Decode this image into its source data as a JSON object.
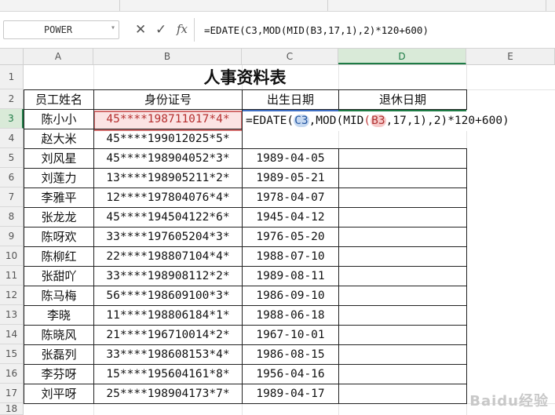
{
  "formula_bar": {
    "name_box": "POWER",
    "formula": "=EDATE(C3,MOD(MID(B3,17,1),2)*120+600)"
  },
  "icons": [
    "cancel-icon",
    "check-icon",
    "fx-icon",
    "dropdown-icon"
  ],
  "columns": [
    "A",
    "B",
    "C",
    "D",
    "E"
  ],
  "rows": [
    "1",
    "2",
    "3",
    "4",
    "5",
    "6",
    "7",
    "8",
    "9",
    "10",
    "11",
    "12",
    "13",
    "14",
    "15",
    "16",
    "17",
    "18"
  ],
  "sheet": {
    "title": "人事资料表",
    "headers": {
      "name": "员工姓名",
      "id": "身份证号",
      "birth": "出生日期",
      "retire": "退休日期"
    },
    "active_formula": {
      "prefix": "=EDATE(",
      "ref1": "C3",
      "mid1": ",MOD(MID",
      "open": "(",
      "ref2": "B3",
      "rest": ",17,1)",
      "tail": ",2)*120+600)"
    },
    "records": [
      {
        "name": "陈小小",
        "id": "45****198711017*4*",
        "birth": ""
      },
      {
        "name": "赵大米",
        "id": "45****199012025*5*",
        "birth": ""
      },
      {
        "name": "刘风星",
        "id": "45****198904052*3*",
        "birth": "1989-04-05"
      },
      {
        "name": "刘莲力",
        "id": "13****198905211*2*",
        "birth": "1989-05-21"
      },
      {
        "name": "李雅平",
        "id": "12****197804076*4*",
        "birth": "1978-04-07"
      },
      {
        "name": "张龙龙",
        "id": "45****194504122*6*",
        "birth": "1945-04-12"
      },
      {
        "name": "陈呀欢",
        "id": "33****197605204*3*",
        "birth": "1976-05-20"
      },
      {
        "name": "陈柳红",
        "id": "22****198807104*4*",
        "birth": "1988-07-10"
      },
      {
        "name": "张甜吖",
        "id": "33****198908112*2*",
        "birth": "1989-08-11"
      },
      {
        "name": "陈马梅",
        "id": "56****198609100*3*",
        "birth": "1986-09-10"
      },
      {
        "name": "李晓",
        "id": "11****198806184*1*",
        "birth": "1988-06-18"
      },
      {
        "name": "陈晓风",
        "id": "21****196710014*2*",
        "birth": "1967-10-01"
      },
      {
        "name": "张磊列",
        "id": "33****198608153*4*",
        "birth": "1986-08-15"
      },
      {
        "name": "李芬呀",
        "id": "15****195604161*8*",
        "birth": "1956-04-16"
      },
      {
        "name": "刘平呀",
        "id": "25****198904173*7*",
        "birth": "1989-04-17"
      }
    ]
  },
  "watermark": "Baidu经验"
}
